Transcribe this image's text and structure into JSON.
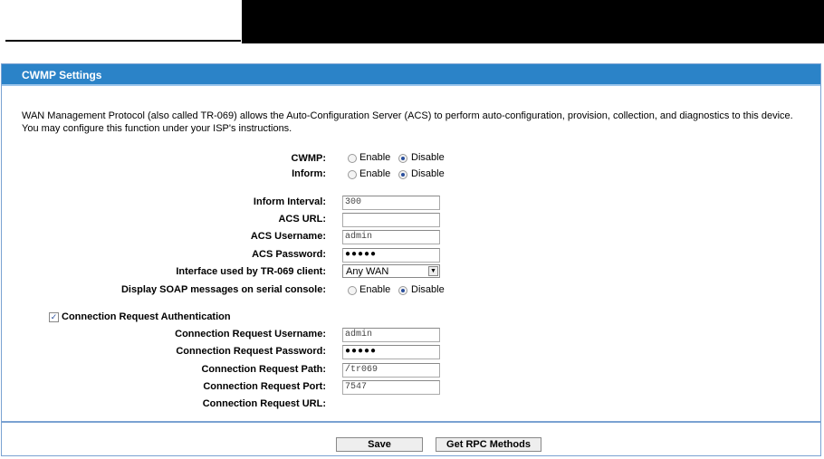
{
  "panel": {
    "title": "CWMP Settings"
  },
  "description": "WAN Management Protocol (also called TR-069) allows the Auto-Configuration Server (ACS) to perform auto-configuration, provision, collection, and diagnostics to this device. You may configure this function under your ISP's instructions.",
  "cwmp": {
    "label": "CWMP:",
    "enable": "Enable",
    "disable": "Disable",
    "selected": "Disable"
  },
  "inform": {
    "label": "Inform:",
    "enable": "Enable",
    "disable": "Disable",
    "selected": "Disable"
  },
  "inform_interval": {
    "label": "Inform Interval:",
    "value": "300"
  },
  "acs_url": {
    "label": "ACS URL:",
    "value": ""
  },
  "acs_username": {
    "label": "ACS Username:",
    "value": "admin"
  },
  "acs_password": {
    "label": "ACS Password:",
    "value": "●●●●●"
  },
  "interface": {
    "label": "Interface used by TR-069 client:",
    "value": "Any WAN"
  },
  "soap": {
    "label": "Display SOAP messages on serial console:",
    "enable": "Enable",
    "disable": "Disable",
    "selected": "Disable"
  },
  "conn_auth": {
    "label": "Connection Request Authentication",
    "checked": true
  },
  "conn_username": {
    "label": "Connection Request Username:",
    "value": "admin"
  },
  "conn_password": {
    "label": "Connection Request Password:",
    "value": "●●●●●"
  },
  "conn_path": {
    "label": "Connection Request Path:",
    "value": "/tr069"
  },
  "conn_port": {
    "label": "Connection Request Port:",
    "value": "7547"
  },
  "conn_url": {
    "label": "Connection Request URL:",
    "value": ""
  },
  "buttons": {
    "save": "Save",
    "rpc": "Get RPC Methods"
  },
  "colors": {
    "header": "#2b83c8",
    "border": "#7aa2d2"
  }
}
